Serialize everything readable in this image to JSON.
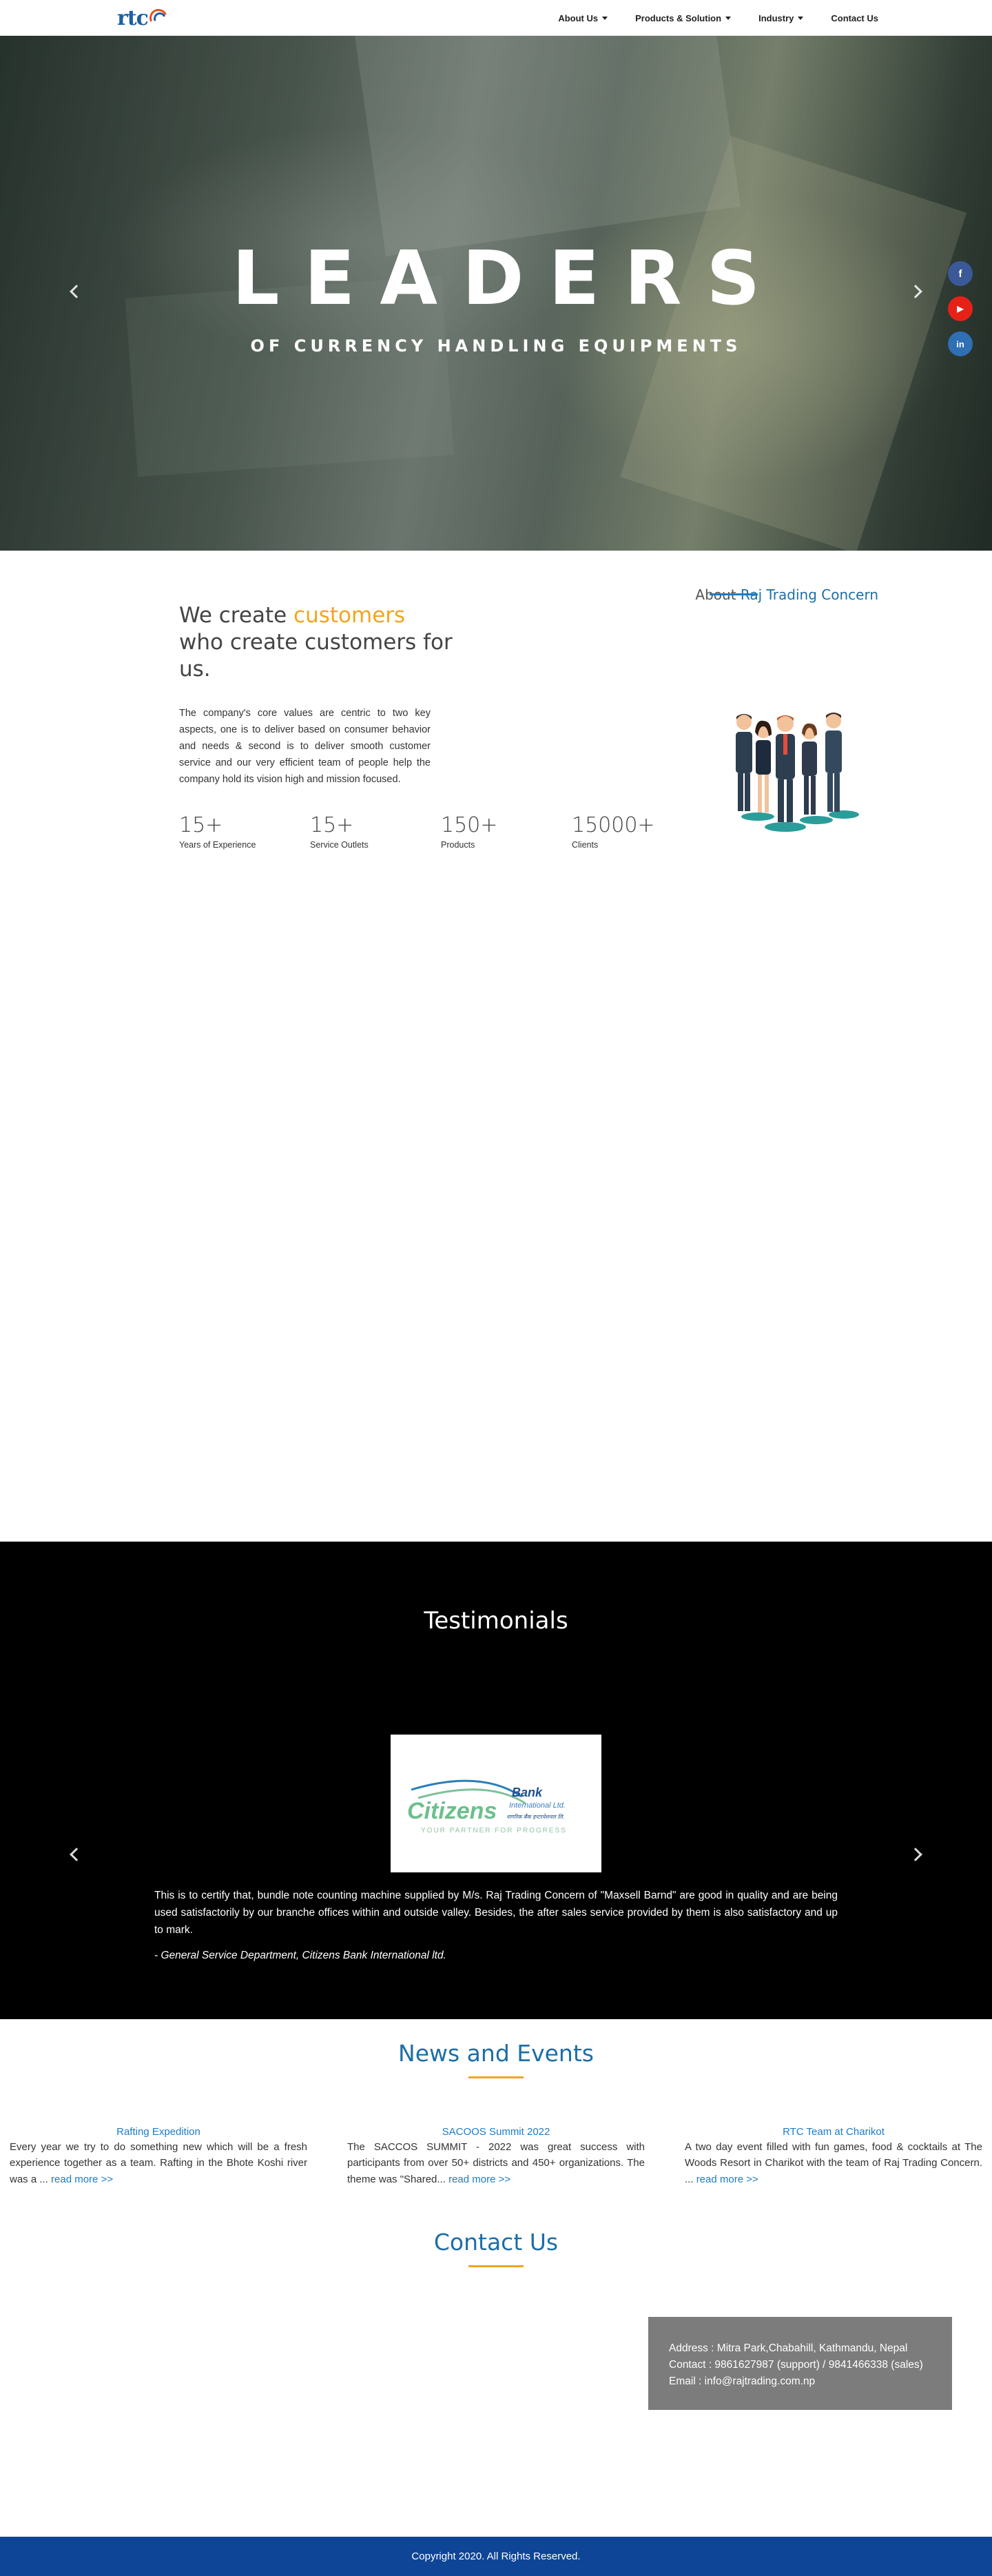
{
  "nav": {
    "logo_text": "rtc",
    "items": [
      {
        "label": "About Us",
        "dropdown": true
      },
      {
        "label": "Products & Solution",
        "dropdown": true
      },
      {
        "label": "Industry",
        "dropdown": true
      },
      {
        "label": "Contact Us",
        "dropdown": false
      }
    ]
  },
  "hero": {
    "title": "LEADERS",
    "subtitle": "OF CURRENCY HANDLING EQUIPMENTS"
  },
  "social": [
    {
      "icon": "facebook-icon",
      "glyph": "f",
      "color": "#3b5998"
    },
    {
      "icon": "youtube-icon",
      "glyph": "▶",
      "color": "#e62117"
    },
    {
      "icon": "linkedin-icon",
      "glyph": "in",
      "color": "#2f6fb3"
    }
  ],
  "about": {
    "heading_prefix": "About",
    "heading_brand": "Raj Trading Concern",
    "headline_start": "We create",
    "headline_accent": "customers",
    "headline_end": "who create customers for us.",
    "paragraph": "The company's core values are centric to two key aspects, one is to deliver based on consumer behavior and needs & second is to deliver smooth customer service and our very efficient team of people help the company hold its vision high and mission focused.",
    "stats": [
      {
        "num": "15+",
        "label": "Years of Experience"
      },
      {
        "num": "15+",
        "label": "Service Outlets"
      },
      {
        "num": "150+",
        "label": "Products"
      },
      {
        "num": "15000+",
        "label": "Clients"
      }
    ]
  },
  "testimonials": {
    "title": "Testimonials",
    "logo_name": "Citizens",
    "logo_line1": "Bank",
    "logo_line2": "International Ltd.",
    "logo_line3": "नागरिक बैंक इन्टरनेशनल लि.",
    "logo_tagline": "YOUR PARTNER FOR PROGRESS",
    "text": "This is to certify that, bundle note counting machine supplied by M/s. Raj Trading Concern of \"Maxsell Barnd\" are good in quality and are being used satisfactorily by our branche offices within and outside valley. Besides, the after sales service provided by them is also satisfactory and up to mark.",
    "author": "- General Service Department, Citizens Bank International ltd."
  },
  "news": {
    "title": "News and Events",
    "more_label": "read more >>",
    "items": [
      {
        "title": "Rafting Expedition",
        "text": "Every year we try to do something new which will be a fresh experience together as a team. Rafting in the Bhote Koshi river was a ..."
      },
      {
        "title": "SACOOS Summit 2022",
        "text": "The SACCOS SUMMIT - 2022 was great success with participants from over 50+ districts and 450+ organizations. The theme was \"Shared..."
      },
      {
        "title": "RTC Team at Charikot",
        "text": "A two day event filled with fun games, food & cocktails at The Woods Resort in Charikot with the team of Raj Trading Concern. ..."
      }
    ]
  },
  "contact": {
    "title": "Contact Us",
    "address": "Address : Mitra Park,Chabahill, Kathmandu, Nepal",
    "phone": "Contact : 9861627987 (support) / 9841466338 (sales)",
    "email": "Email : info@rajtrading.com.np"
  },
  "footer": {
    "copyright": "Copyright 2020. All Rights Reserved."
  }
}
